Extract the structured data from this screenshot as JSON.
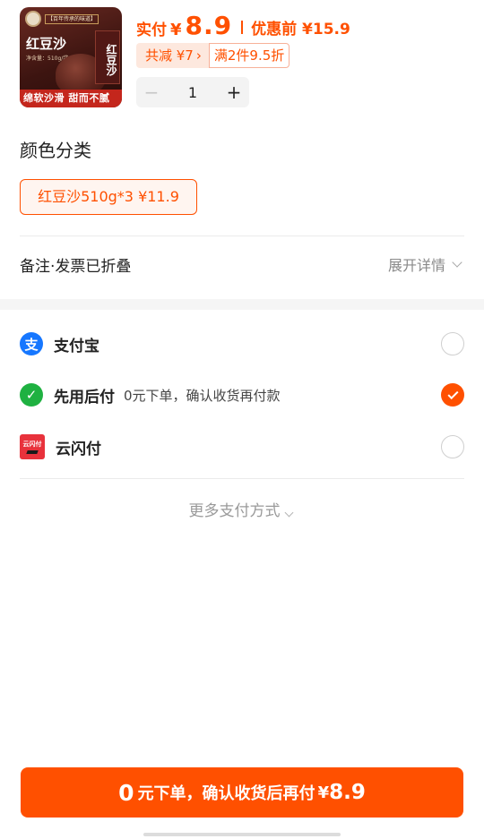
{
  "product": {
    "thumbnail": {
      "tagline": "【百年传承的味道】",
      "name": "红豆沙",
      "weight": "净含量：510g/袋",
      "box_text": "红豆沙",
      "banner": "绵软沙滑 甜而不腻"
    },
    "actual_label": "实付",
    "currency": "¥",
    "actual_price": "8.9",
    "original_label": "优惠前 ¥15.9",
    "total_discount": "共减 ¥7",
    "promo": "满2件9.5折",
    "quantity": "1",
    "minus_label": "−",
    "plus_label": "+"
  },
  "variants": {
    "title": "颜色分类",
    "selected": "红豆沙510g*3  ¥11.9"
  },
  "notes": {
    "label": "备注·发票已折叠",
    "expand_label": "展开详情"
  },
  "payment": {
    "methods": [
      {
        "name": "支付宝",
        "icon": "alipay-icon",
        "icon_text": "支",
        "desc": "",
        "selected": false
      },
      {
        "name": "先用后付",
        "icon": "pay-later-icon",
        "icon_text": "✓",
        "desc": "0元下单，确认收货再付款",
        "selected": true
      },
      {
        "name": "云闪付",
        "icon": "unionpay-icon",
        "icon_text": "云闪付",
        "desc": "",
        "selected": false
      }
    ],
    "more_label": "更多支付方式"
  },
  "submit": {
    "zero": "0",
    "text": "元下单，确认收货后再付",
    "currency": "¥",
    "amount": "8.9"
  },
  "colors": {
    "accent": "#ff5000",
    "alipay": "#1677ff",
    "pay_later": "#1fb141",
    "unionpay": "#e8323c"
  }
}
